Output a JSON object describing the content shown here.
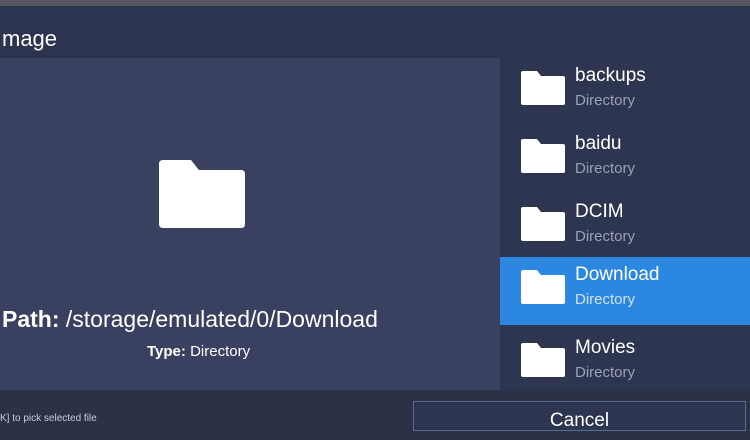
{
  "dialog": {
    "title": "mage"
  },
  "preview": {
    "icon": "folder-icon",
    "path_label": "Path:",
    "path_value": "/storage/emulated/0/Download",
    "type_label": "Type:",
    "type_value": "Directory"
  },
  "files": [
    {
      "name": "backups",
      "type": "Directory",
      "icon": "folder-icon",
      "selected": false
    },
    {
      "name": "baidu",
      "type": "Directory",
      "icon": "folder-icon",
      "selected": false
    },
    {
      "name": "DCIM",
      "type": "Directory",
      "icon": "folder-icon",
      "selected": false
    },
    {
      "name": "Download",
      "type": "Directory",
      "icon": "folder-icon",
      "selected": true
    },
    {
      "name": "Movies",
      "type": "Directory",
      "icon": "folder-icon",
      "selected": false
    }
  ],
  "footer": {
    "hint": "K] to pick selected file",
    "cancel_label": "Cancel"
  },
  "colors": {
    "background": "#2b3147",
    "preview_panel": "#3a4160",
    "list_panel": "#2e3550",
    "selection": "#2b87e0"
  }
}
